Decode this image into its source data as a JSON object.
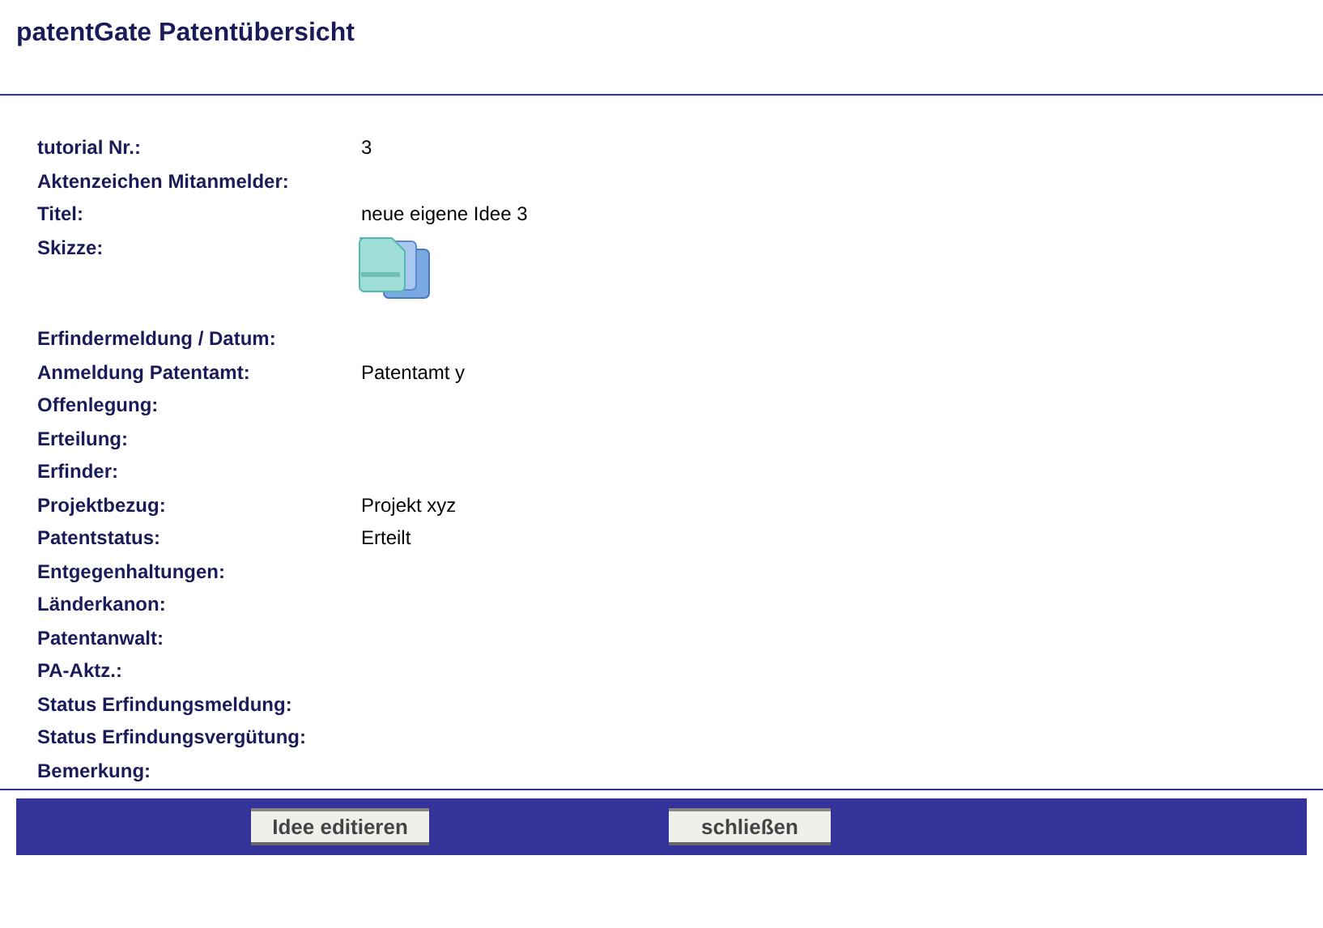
{
  "title": "patentGate Patentübersicht",
  "rows": [
    {
      "kind": "text",
      "label": "tutorial Nr.:",
      "value": "3"
    },
    {
      "kind": "text",
      "label": "Aktenzeichen Mitanmelder:"
    },
    {
      "kind": "text",
      "label": "Titel:",
      "value": "neue eigene Idee 3"
    },
    {
      "kind": "image",
      "label": "Skizze:"
    },
    {
      "kind": "text",
      "label": "Erfindermeldung / Datum:"
    },
    {
      "kind": "text",
      "label": "Anmeldung Patentamt:",
      "value": "Patentamt y"
    },
    {
      "kind": "text",
      "label": "Offenlegung:"
    },
    {
      "kind": "text",
      "label": "Erteilung:"
    },
    {
      "kind": "text",
      "label": "Erfinder:"
    },
    {
      "kind": "text",
      "label": "Projektbezug:",
      "value": "Projekt xyz"
    },
    {
      "kind": "text",
      "label": "Patentstatus:",
      "value": "Erteilt"
    },
    {
      "kind": "text",
      "label": "Entgegenhaltungen:"
    },
    {
      "kind": "text",
      "label": "Länderkanon:"
    },
    {
      "kind": "text",
      "label": "Patentanwalt:"
    },
    {
      "kind": "text",
      "label": "PA-Aktz.:"
    },
    {
      "kind": "text",
      "label": "Status Erfindungsmeldung:"
    },
    {
      "kind": "text",
      "label": "Status Erfindungsvergütung:"
    },
    {
      "kind": "text",
      "label": "Bemerkung:"
    }
  ],
  "buttons": [
    "Idee editieren",
    "schließen"
  ]
}
